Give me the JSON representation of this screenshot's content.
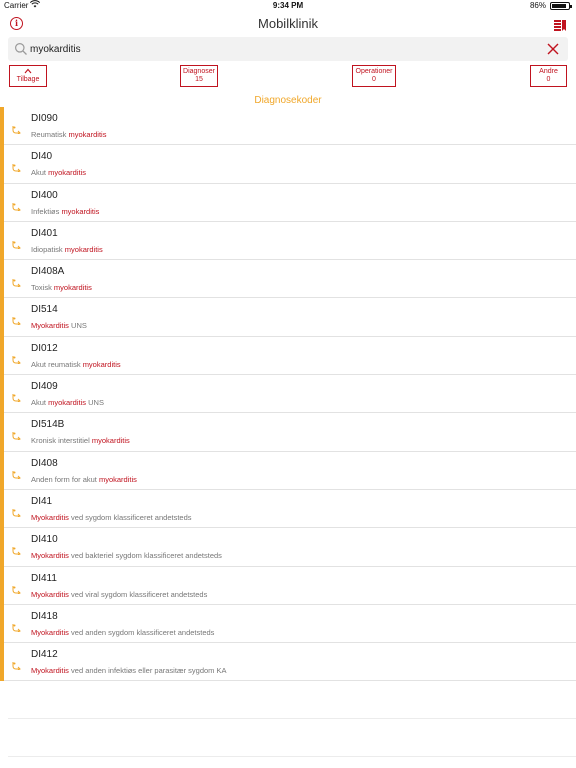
{
  "status_bar": {
    "carrier": "Carrier",
    "time": "9:34 PM",
    "battery": "86%"
  },
  "nav": {
    "title": "Mobilklinik",
    "info_icon": "info-icon",
    "book_icon": "book-icon"
  },
  "search": {
    "value": "myokarditis",
    "placeholder": "",
    "search_icon": "search-icon",
    "clear_icon": "close-icon"
  },
  "filters": {
    "back": {
      "label": "Tilbage"
    },
    "diagnoser": {
      "label": "Diagnoser",
      "count": "15"
    },
    "operationer": {
      "label": "Operationer",
      "count": "0"
    },
    "andre": {
      "label": "Andre",
      "count": "0"
    }
  },
  "section_title": "Diagnosekoder",
  "colors": {
    "accent_red": "#c0131f",
    "accent_orange": "#f0a72a"
  },
  "results": [
    {
      "code": "DI090",
      "pre": "Reumatisk ",
      "hl": "myokarditis",
      "post": ""
    },
    {
      "code": "DI40",
      "pre": "Akut ",
      "hl": "myokarditis",
      "post": ""
    },
    {
      "code": "DI400",
      "pre": "Infektiøs ",
      "hl": "myokarditis",
      "post": ""
    },
    {
      "code": "DI401",
      "pre": "Idiopatisk ",
      "hl": "myokarditis",
      "post": ""
    },
    {
      "code": "DI408A",
      "pre": "Toxisk ",
      "hl": "myokarditis",
      "post": ""
    },
    {
      "code": "DI514",
      "pre": "",
      "hl": "Myokarditis",
      "post": " UNS"
    },
    {
      "code": "DI012",
      "pre": "Akut reumatisk ",
      "hl": "myokarditis",
      "post": ""
    },
    {
      "code": "DI409",
      "pre": "Akut ",
      "hl": "myokarditis",
      "post": " UNS"
    },
    {
      "code": "DI514B",
      "pre": "Kronisk interstitiel ",
      "hl": "myokarditis",
      "post": ""
    },
    {
      "code": "DI408",
      "pre": "Anden form for akut ",
      "hl": "myokarditis",
      "post": ""
    },
    {
      "code": "DI41",
      "pre": "",
      "hl": "Myokarditis",
      "post": " ved sygdom klassificeret andetsteds"
    },
    {
      "code": "DI410",
      "pre": "",
      "hl": "Myokarditis",
      "post": " ved bakteriel sygdom klassificeret andetsteds"
    },
    {
      "code": "DI411",
      "pre": "",
      "hl": "Myokarditis",
      "post": " ved viral sygdom klassificeret andetsteds"
    },
    {
      "code": "DI418",
      "pre": "",
      "hl": "Myokarditis",
      "post": " ved anden sygdom klassificeret andetsteds"
    },
    {
      "code": "DI412",
      "pre": "",
      "hl": "Myokarditis",
      "post": " ved anden infektiøs eller parasitær sygdom KA"
    }
  ]
}
